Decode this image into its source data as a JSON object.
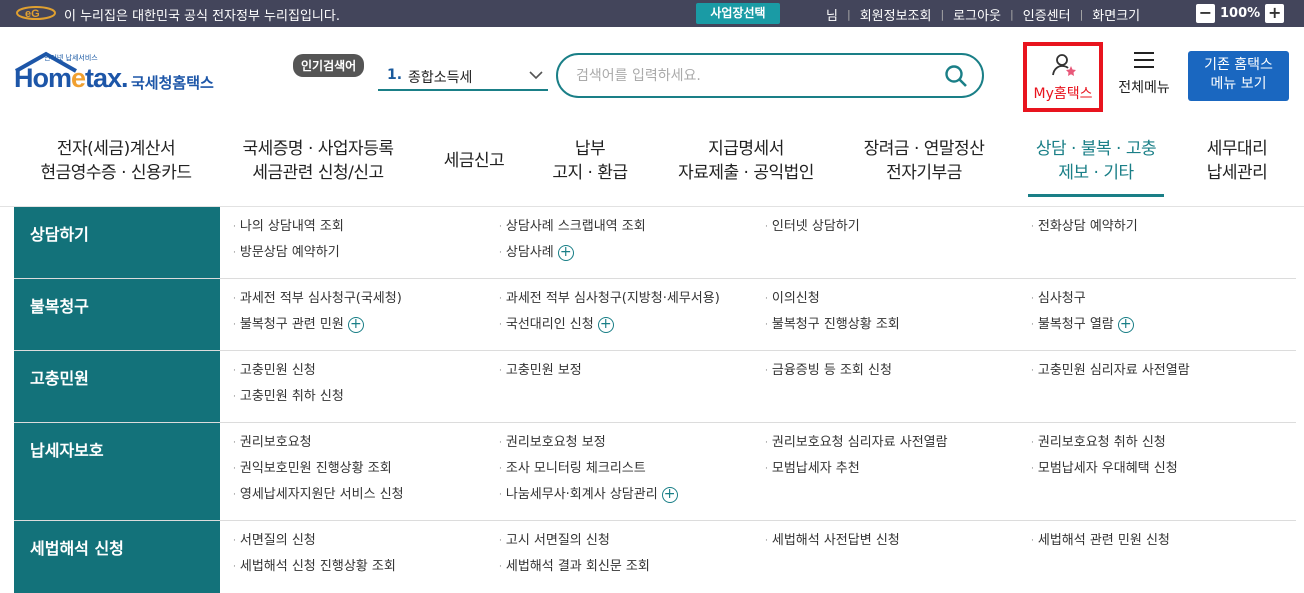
{
  "govbar": {
    "text": "이 누리집은 대한민국 공식 전자정부 누리집입니다.",
    "biz_button": "사업장선택",
    "user_suffix": "님",
    "links": [
      "회원정보조회",
      "로그아웃",
      "인증센터",
      "화면크기"
    ],
    "zoom_minus": "−",
    "zoom_value": "100%",
    "zoom_plus": "+"
  },
  "header": {
    "logo_small": "인터넷 납세서비스",
    "logo_text_pre": "Hom",
    "logo_text_e": "e",
    "logo_text_post": "tax.",
    "logo_kor": "국세청홈택스",
    "popular_label": "인기검색어",
    "popular_num": "1.",
    "popular_term": "종합소득세",
    "search_placeholder": "검색어를 입력하세요.",
    "myhome_label": "My홈택스",
    "allmenu_label": "전체메뉴",
    "legacy_line1": "기존 홈택스",
    "legacy_line2": "메뉴 보기"
  },
  "nav": [
    {
      "l1": "전자(세금)계산서",
      "l2": "현금영수증 · 신용카드"
    },
    {
      "l1": "국세증명 · 사업자등록",
      "l2": "세금관련 신청/신고"
    },
    {
      "l1": "세금신고",
      "l2": ""
    },
    {
      "l1": "납부",
      "l2": "고지 · 환급"
    },
    {
      "l1": "지급명세서",
      "l2": "자료제출 · 공익법인"
    },
    {
      "l1": "장려금 · 연말정산",
      "l2": "전자기부금"
    },
    {
      "l1": "상담 · 불복 · 고충",
      "l2": "제보 · 기타"
    },
    {
      "l1": "세무대리",
      "l2": "납세관리"
    }
  ],
  "sections": [
    {
      "title": "상담하기",
      "links": [
        "나의 상담내역 조회",
        "상담사례 스크랩내역 조회",
        "인터넷 상담하기",
        "전화상담 예약하기",
        "방문상담 예약하기",
        "상담사례"
      ]
    },
    {
      "title": "불복청구",
      "links": [
        "과세전 적부 심사청구(국세청)",
        "과세전 적부 심사청구(지방청·세무서용)",
        "이의신청",
        "심사청구",
        "불복청구 관련 민원",
        "국선대리인 신청",
        "불복청구 진행상황 조회",
        "불복청구 열람"
      ]
    },
    {
      "title": "고충민원",
      "links": [
        "고충민원 신청",
        "고충민원 보정",
        "금융증빙 등 조회 신청",
        "고충민원 심리자료 사전열람",
        "고충민원 취하 신청"
      ]
    },
    {
      "title": "납세자보호",
      "links": [
        "권리보호요청",
        "권리보호요청 보정",
        "권리보호요청 심리자료 사전열람",
        "권리보호요청 취하 신청",
        "권익보호민원 진행상황 조회",
        "조사 모니터링 체크리스트",
        "모범납세자 추천",
        "모범납세자 우대혜택 신청",
        "영세납세자지원단 서비스 신청",
        "나눔세무사·회계사 상담관리"
      ]
    },
    {
      "title": "세법해석 신청",
      "links": [
        "서면질의 신청",
        "고시 서면질의 신청",
        "세법해석 사전답변 신청",
        "세법해석 관련 민원 신청",
        "세법해석 신청 진행상황 조회",
        "세법해석 결과 회신문 조회"
      ]
    }
  ],
  "colors": {
    "teal": "#13727a",
    "navy_bar": "#43455b",
    "highlight": "#e8141e",
    "legacy_btn": "#1a67c0"
  }
}
